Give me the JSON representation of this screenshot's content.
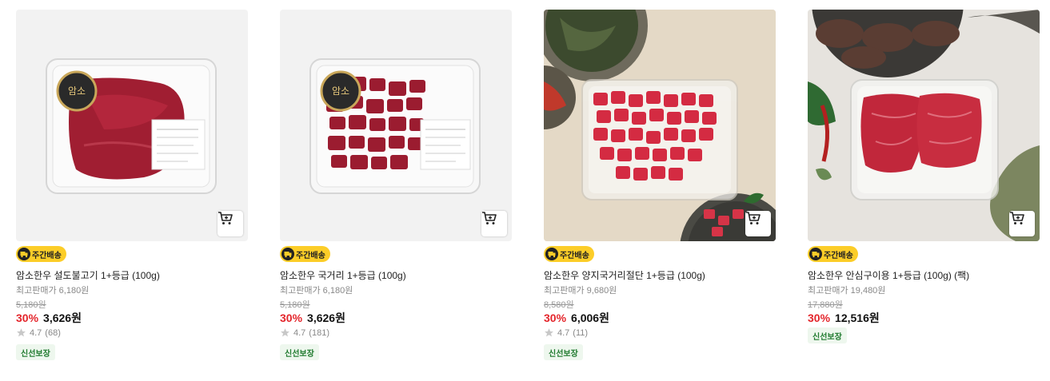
{
  "colors": {
    "discount": "#e4262c",
    "badge_bg": "#fccd28",
    "fresh_text": "#1f7a2e",
    "fresh_bg": "#eef7ee"
  },
  "icons": {
    "cart": "cart-icon",
    "delivery": "delivery-truck-icon",
    "star": "star-icon"
  },
  "products": [
    {
      "badge": "주간배송",
      "name": "암소한우 설도불고기 1+등급 (100g)",
      "max_price": "최고판매가 6,180원",
      "original_price": "5,180원",
      "discount": "30%",
      "price": "3,626원",
      "rating": "4.7",
      "reviews": "(68)",
      "tag": "신선보장"
    },
    {
      "badge": "주간배송",
      "name": "암소한우 국거리 1+등급 (100g)",
      "max_price": "최고판매가 6,180원",
      "original_price": "5,180원",
      "discount": "30%",
      "price": "3,626원",
      "rating": "4.7",
      "reviews": "(181)",
      "tag": "신선보장"
    },
    {
      "badge": "주간배송",
      "name": "암소한우 양지국거리절단 1+등급 (100g)",
      "max_price": "최고판매가 9,680원",
      "original_price": "8,580원",
      "discount": "30%",
      "price": "6,006원",
      "rating": "4.7",
      "reviews": "(11)",
      "tag": "신선보장"
    },
    {
      "badge": "주간배송",
      "name": "암소한우 안심구이용 1+등급 (100g) (팩)",
      "max_price": "최고판매가 19,480원",
      "original_price": "17,880원",
      "discount": "30%",
      "price": "12,516원",
      "tag": "신선보장"
    }
  ]
}
